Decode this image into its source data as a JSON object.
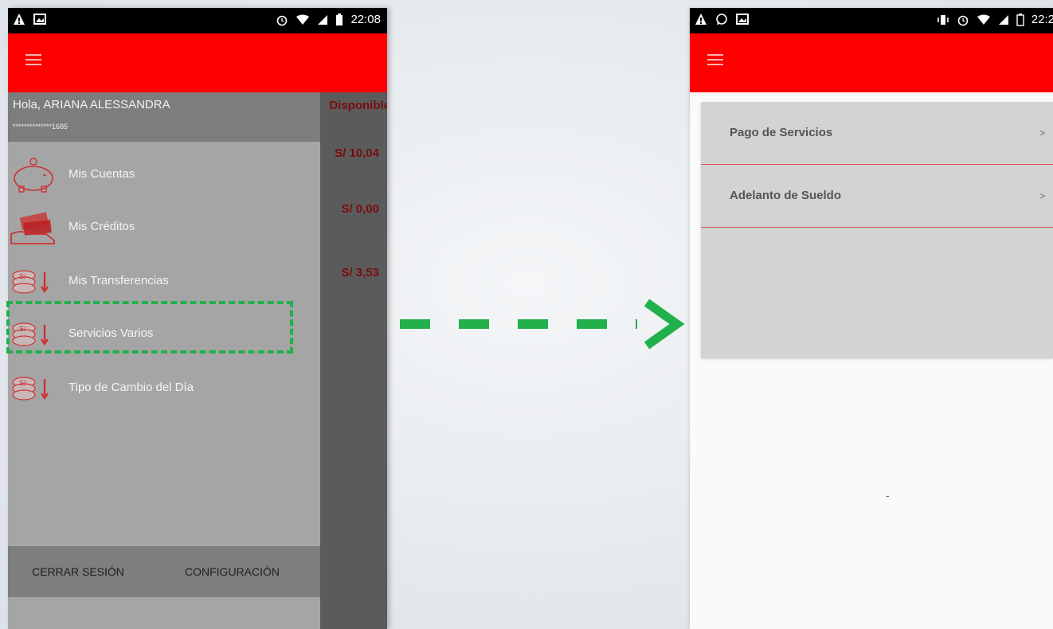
{
  "left_screen": {
    "status": {
      "time": "22:08"
    },
    "drawer": {
      "greeting": "Hola, ARIANA ALESSANDRA",
      "account": "**************1685",
      "items": [
        {
          "label": "Mis Cuentas",
          "icon": "piggy-bank-icon"
        },
        {
          "label": "Mis Créditos",
          "icon": "money-hand-icon"
        },
        {
          "label": "Mis Transferencias",
          "icon": "coins-transfer-icon"
        },
        {
          "label": "Servicios Varios",
          "icon": "coins-transfer-icon"
        },
        {
          "label": "Tipo de Cambio del Día",
          "icon": "coins-transfer-icon"
        }
      ],
      "footer": {
        "logout": "CERRAR SESIÓN",
        "settings": "CONFIGURACIÓN"
      }
    },
    "background": {
      "header": "Disponible",
      "balances": [
        "S/ 10,04",
        "S/ 0,00",
        "S/ 3,53"
      ]
    }
  },
  "right_screen": {
    "status": {
      "time": "22:2"
    },
    "menu": [
      {
        "label": "Pago de Servicios",
        "chevron": ">"
      },
      {
        "label": "Adelanto de Sueldo",
        "chevron": ">"
      }
    ],
    "placeholder": "-"
  },
  "colors": {
    "appbar": "#ff0000",
    "highlight": "#22b04b",
    "balance": "#7a0d0d"
  }
}
